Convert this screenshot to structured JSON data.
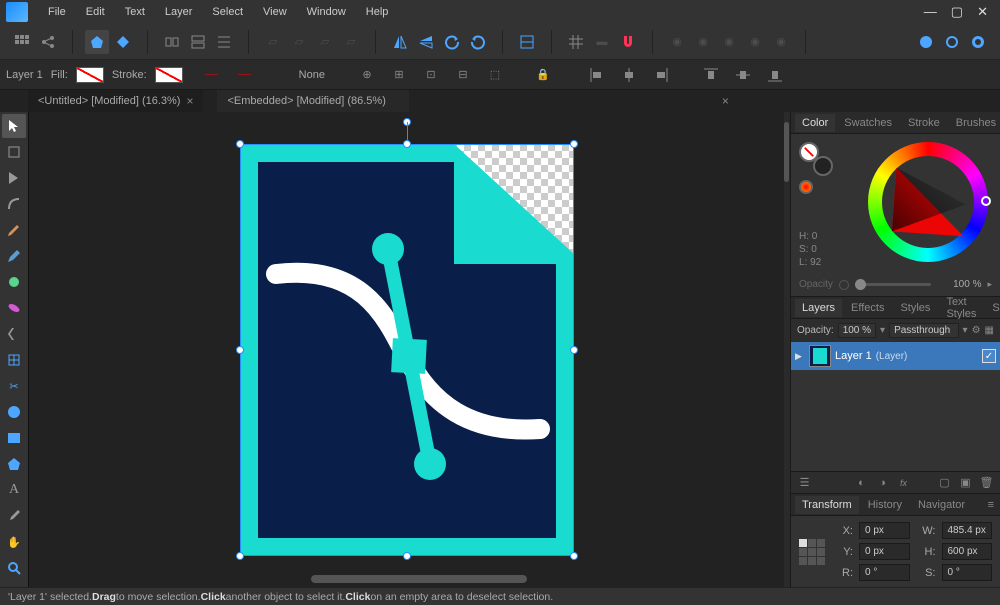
{
  "menu": {
    "items": [
      "File",
      "Edit",
      "Text",
      "Layer",
      "Select",
      "View",
      "Window",
      "Help"
    ]
  },
  "ctx": {
    "layerLabel": "Layer 1",
    "fillLabel": "Fill:",
    "strokeLabel": "Stroke:",
    "strokeWidth": "None"
  },
  "tabs": [
    {
      "title": "<Untitled> [Modified] (16.3%)",
      "active": false
    },
    {
      "title": "<Embedded> [Modified] (86.5%)",
      "active": true
    }
  ],
  "colorPanel": {
    "tabs": [
      "Color",
      "Swatches",
      "Stroke",
      "Brushes"
    ],
    "hsl": {
      "h": "H: 0",
      "s": "S: 0",
      "l": "L: 92"
    },
    "opacityLabel": "Opacity",
    "opacityValue": "100 %"
  },
  "layersPanel": {
    "tabs": [
      "Layers",
      "Effects",
      "Styles",
      "Text Styles",
      "Stock"
    ],
    "opacityLabel": "Opacity:",
    "opacityValue": "100 %",
    "blendMode": "Passthrough",
    "layers": [
      {
        "name": "Layer 1",
        "type": "(Layer)"
      }
    ]
  },
  "transformPanel": {
    "tabs": [
      "Transform",
      "History",
      "Navigator"
    ],
    "x": {
      "label": "X:",
      "value": "0 px"
    },
    "y": {
      "label": "Y:",
      "value": "0 px"
    },
    "w": {
      "label": "W:",
      "value": "485.4 px"
    },
    "h": {
      "label": "H:",
      "value": "600 px"
    },
    "r": {
      "label": "R:",
      "value": "0 °"
    },
    "s": {
      "label": "S:",
      "value": "0 °"
    }
  },
  "status": {
    "prefix": "'Layer 1' selected. ",
    "drag": "Drag",
    "mid1": " to move selection. ",
    "click1": "Click",
    "mid2": " another object to select it. ",
    "click2": "Click",
    "end": " on an empty area to deselect selection."
  },
  "artColors": {
    "cyan": "#1adbd0",
    "navy": "#0a1e4a"
  }
}
